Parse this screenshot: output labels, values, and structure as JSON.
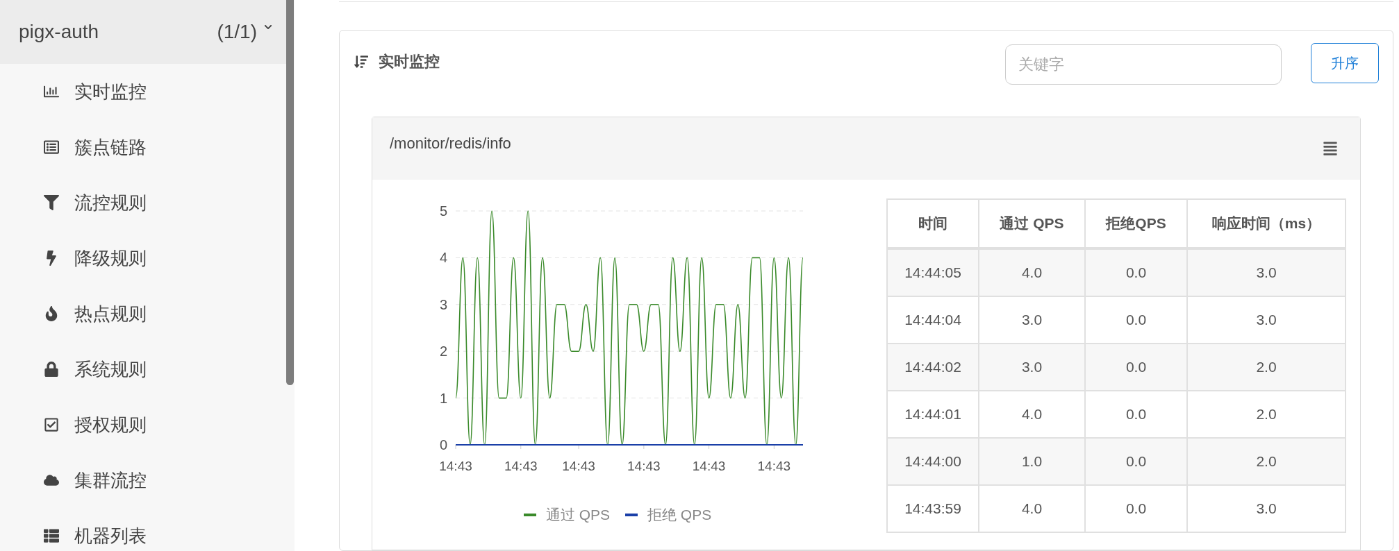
{
  "sidebar": {
    "app": {
      "name": "pigx-auth",
      "count": "(1/1)",
      "expanded": true
    },
    "items": [
      {
        "label": "实时监控"
      },
      {
        "label": "簇点链路"
      },
      {
        "label": "流控规则"
      },
      {
        "label": "降级规则"
      },
      {
        "label": "热点规则"
      },
      {
        "label": "系统规则"
      },
      {
        "label": "授权规则"
      },
      {
        "label": "集群流控"
      },
      {
        "label": "机器列表"
      }
    ]
  },
  "panel": {
    "title": "实时监控",
    "search": {
      "placeholder": "关键字"
    },
    "sort_button": "升序",
    "cards": [
      {
        "resource": "/monitor/redis/info",
        "chart_data": {
          "type": "line",
          "categories": [
            "14:43",
            null,
            null,
            null,
            null,
            null,
            null,
            null,
            null,
            "14:43",
            null,
            null,
            null,
            null,
            null,
            null,
            null,
            "14:43",
            null,
            null,
            null,
            null,
            null,
            null,
            null,
            null,
            "14:43",
            null,
            null,
            null,
            null,
            null,
            null,
            null,
            null,
            "14:43",
            null,
            null,
            null,
            null,
            null,
            null,
            null,
            null,
            "14:43",
            null,
            null,
            null,
            null
          ],
          "series": [
            {
              "name": "通过 QPS",
              "color": "#3a8a2a",
              "values": [
                1,
                4,
                0,
                4,
                0,
                5,
                1,
                1,
                4,
                1,
                5,
                0,
                4,
                1,
                3,
                3,
                2,
                2,
                3,
                2,
                4,
                0,
                4,
                0,
                3,
                3,
                2,
                3,
                3,
                0,
                4,
                2,
                4,
                0,
                4,
                1,
                3,
                3,
                1,
                3,
                1,
                4,
                4,
                0,
                4,
                1,
                4,
                0,
                4
              ]
            },
            {
              "name": "拒绝 QPS",
              "color": "#1a3fa8",
              "values": [
                0,
                0,
                0,
                0,
                0,
                0,
                0,
                0,
                0,
                0,
                0,
                0,
                0,
                0,
                0,
                0,
                0,
                0,
                0,
                0,
                0,
                0,
                0,
                0,
                0,
                0,
                0,
                0,
                0,
                0,
                0,
                0,
                0,
                0,
                0,
                0,
                0,
                0,
                0,
                0,
                0,
                0,
                0,
                0,
                0,
                0,
                0,
                0,
                0
              ]
            }
          ],
          "ylim": [
            0,
            5
          ],
          "yticks": [
            0,
            1,
            2,
            3,
            4,
            5
          ],
          "grid": true
        },
        "table": {
          "columns": [
            "时间",
            "通过 QPS",
            "拒绝QPS",
            "响应时间（ms）"
          ],
          "rows": [
            [
              "14:44:05",
              "4.0",
              "0.0",
              "3.0"
            ],
            [
              "14:44:04",
              "3.0",
              "0.0",
              "3.0"
            ],
            [
              "14:44:02",
              "3.0",
              "0.0",
              "2.0"
            ],
            [
              "14:44:01",
              "4.0",
              "0.0",
              "2.0"
            ],
            [
              "14:44:00",
              "1.0",
              "0.0",
              "2.0"
            ],
            [
              "14:43:59",
              "4.0",
              "0.0",
              "3.0"
            ]
          ]
        }
      }
    ]
  }
}
